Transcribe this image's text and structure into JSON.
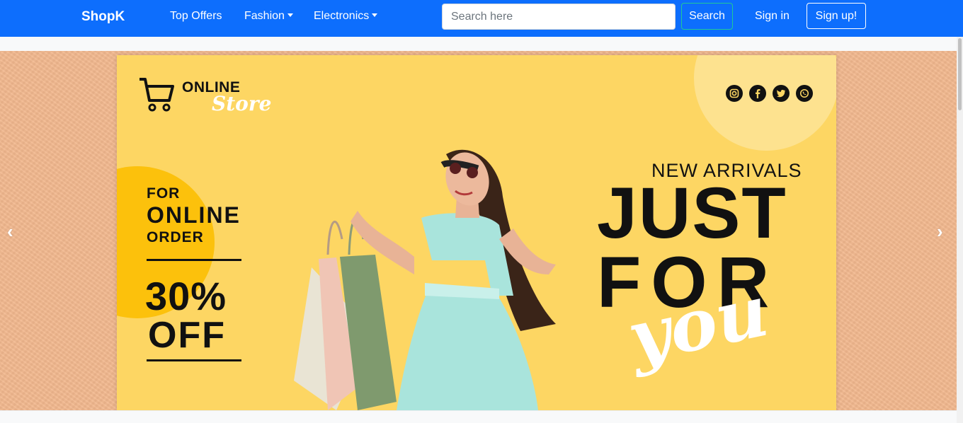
{
  "navbar": {
    "brand": "ShopK",
    "links": [
      {
        "label": "Top Offers"
      },
      {
        "label": "Fashion"
      },
      {
        "label": "Electronics"
      }
    ],
    "search_placeholder": "Search here",
    "search_button": "Search",
    "signin": "Sign in",
    "signup": "Sign up!"
  },
  "carousel": {
    "prev_glyph": "‹",
    "next_glyph": "›",
    "banner": {
      "logo_online": "ONLINE",
      "logo_store": "Store",
      "promo_for": "FOR",
      "promo_online": "ONLINE",
      "promo_order": "ORDER",
      "promo_percent": "30%",
      "promo_off": "OFF",
      "new_arrivals": "NEW ARRIVALS",
      "headline_just": "JUST",
      "headline_for": "FOR",
      "headline_you": "you",
      "social_icons": [
        "instagram-icon",
        "facebook-icon",
        "twitter-icon",
        "whatsapp-icon"
      ]
    }
  },
  "colors": {
    "navbar": "#0d6efd",
    "banner_yellow": "#fdd663",
    "accent_yellow": "#fcc10c",
    "background_peach": "#f2b88e",
    "dress": "#a9e4dc"
  }
}
